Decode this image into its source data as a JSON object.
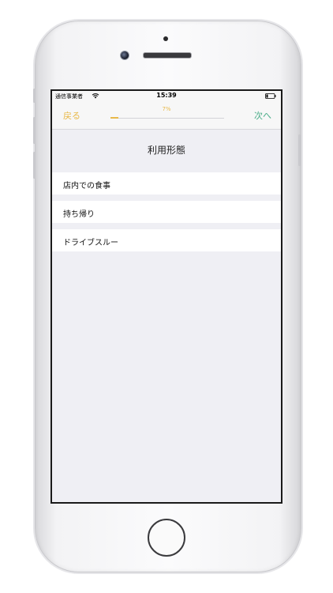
{
  "status_bar": {
    "carrier": "通信事業者",
    "time": "15:39",
    "wifi_icon": "wifi-icon",
    "battery_icon": "battery-icon"
  },
  "nav": {
    "back_label": "戻る",
    "next_label": "次へ",
    "progress_label": "7%",
    "progress_value": 0.07,
    "accent_color": "#e8b94a",
    "next_color": "#4cae8a"
  },
  "page": {
    "title": "利用形態"
  },
  "options": [
    {
      "label": "店内での食事"
    },
    {
      "label": "持ち帰り"
    },
    {
      "label": "ドライブスルー"
    }
  ]
}
